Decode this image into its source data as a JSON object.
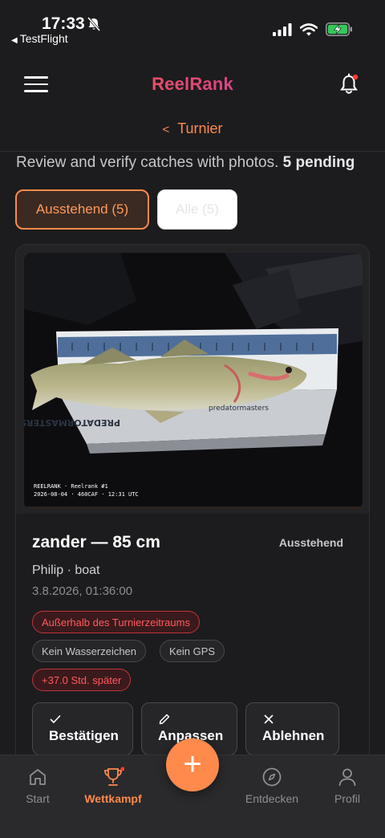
{
  "status_bar": {
    "time": "17:33",
    "back_app": "TestFlight",
    "battery_color": "#34c759"
  },
  "header": {
    "logo": "ReelRank",
    "back_link": "Turnier"
  },
  "subtitle": {
    "text": "Review and verify catches with photos.",
    "pending": "5 pending"
  },
  "tabs": [
    {
      "label": "Ausstehend (5)",
      "active": true
    },
    {
      "label": "Alle (5)",
      "active": false
    }
  ],
  "catch": {
    "photo_caption_line1": "REELRANK · Reelrank #1",
    "photo_caption_line2": "2026-08-04 · 460CAF · 12:31 UTC",
    "title": "zander — 85 cm",
    "status": "Ausstehend",
    "angler": "Philip · boat",
    "date": "3.8.2026, 01:36:00",
    "badges": [
      {
        "label": "Außerhalb des Turnierzeitraums",
        "type": "error"
      },
      {
        "label": "Kein Wasserzeichen",
        "type": "neutral"
      },
      {
        "label": "Kein GPS",
        "type": "neutral"
      },
      {
        "label": "+37.0 Std. später",
        "type": "error"
      }
    ],
    "actions": {
      "confirm": "Bestätigen",
      "adjust": "Anpassen",
      "reject": "Ablehnen"
    }
  },
  "bottom_nav": {
    "items": [
      {
        "label": "Start",
        "icon": "home-icon",
        "active": false
      },
      {
        "label": "Wettkampf",
        "icon": "trophy-icon",
        "active": true
      },
      {
        "label": "Entdecken",
        "icon": "compass-icon",
        "active": false
      },
      {
        "label": "Profil",
        "icon": "user-icon",
        "active": false
      }
    ],
    "fab_symbol": "+"
  },
  "colors": {
    "accent": "#ff8a4c",
    "error": "#ff5a5f",
    "background": "#1c1c1e"
  }
}
